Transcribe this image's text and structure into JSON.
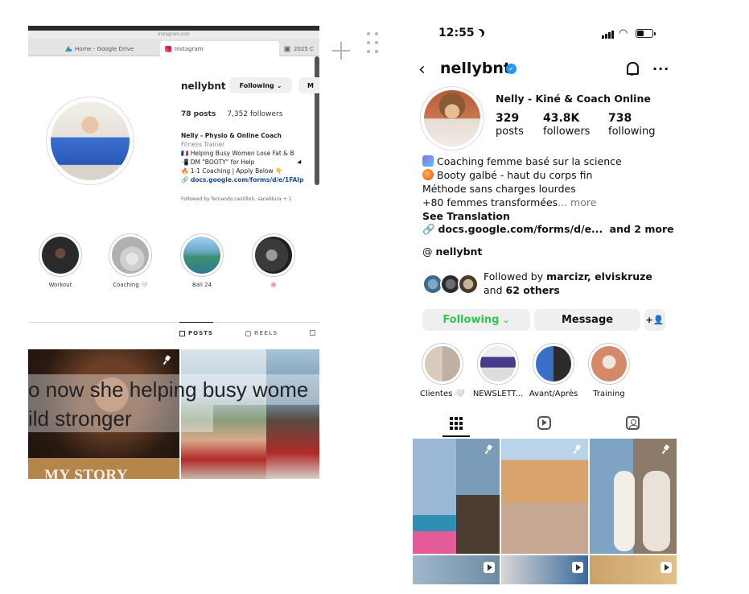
{
  "desktop": {
    "url_text": "instagram.com",
    "tabs": [
      {
        "label": "Home - Google Drive",
        "icon": "google-drive-icon"
      },
      {
        "label": "Instagram",
        "icon": "instagram-icon"
      },
      {
        "label": "2025 C",
        "icon": "app-icon"
      }
    ],
    "profile": {
      "username": "nellybnt",
      "following_label": "Following",
      "message_label": "M",
      "posts": "78 posts",
      "followers": "7,352 followers",
      "name": "Nelly - Physio & Online Coach",
      "category": "Fitness Trainer",
      "bio_lines": [
        "🇫🇷 Helping Busy Women Lose Fat & B",
        "📲 DM \"BOOTY\" for Help",
        "🔥 1-1 Coaching | Apply Below 👇"
      ],
      "link": "docs.google.com/forms/d/e/1FAIp",
      "followed_by": "Followed by fernando.castilloh, saneldura + 1"
    },
    "highlights": [
      {
        "label": "Workout"
      },
      {
        "label": "Coaching 🤍"
      },
      {
        "label": "Bali 24"
      },
      {
        "label": "🌸"
      }
    ],
    "tabs_profile": {
      "posts": "POSTS",
      "reels": "REELS"
    },
    "caption_line1": "o now she helping busy wome",
    "caption_line2": "ild stronger",
    "story_text": "MY STORY"
  },
  "phone": {
    "time": "12:55",
    "username": "nellybnt",
    "name": "Nelly - Kiné & Coach Online",
    "stats": [
      {
        "value": "329",
        "label": "posts"
      },
      {
        "value": "43.8K",
        "label": "followers"
      },
      {
        "value": "738",
        "label": "following"
      }
    ],
    "bio": {
      "line1": "Coaching femme basé sur la science",
      "line2": "Booty galbé - haut du corps fin",
      "line3": "Méthode sans charges lourdes",
      "line4": "+80 femmes transformées",
      "more": "... more",
      "translation": "See Translation"
    },
    "link": "docs.google.com/forms/d/e...",
    "link_more": "and 2 more",
    "threads": "nellybnt",
    "followed_prefix": "Followed by",
    "followed_names": "marcizr, elviskruze",
    "followed_and": "and",
    "followed_others": "62 others",
    "buttons": {
      "following": "Following",
      "message": "Message"
    },
    "highlights": [
      {
        "label": "Clientes 🤍"
      },
      {
        "label": "NEWSLETT..."
      },
      {
        "label": "Avant/Après"
      },
      {
        "label": "Training"
      }
    ]
  },
  "colors": {
    "verified": "#1d9bf0",
    "following_green": "#35c44e",
    "link_blue": "#1b4e8e"
  }
}
